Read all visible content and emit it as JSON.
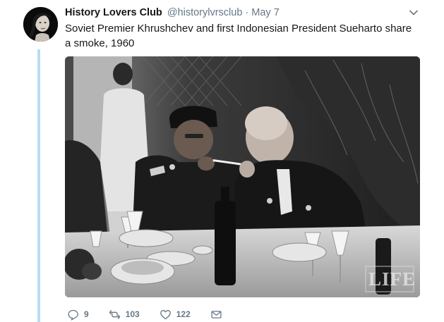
{
  "tweet": {
    "author_name": "History Lovers Club",
    "author_handle": "@historylvrsclub",
    "separator": "·",
    "date": "May 7",
    "text": "Soviet Premier Khrushchev and first Indonesian President Sueharto share a smoke, 1960",
    "media": {
      "watermark": "LIFE",
      "tone": "black-and-white photograph"
    },
    "actions": {
      "replies": "9",
      "retweets": "103",
      "likes": "122"
    }
  },
  "icons": {
    "caret": "chevron-down-icon",
    "reply": "reply-icon",
    "retweet": "retweet-icon",
    "like": "heart-icon",
    "dm": "envelope-icon"
  },
  "colors": {
    "thread_line": "#b8dcf2",
    "secondary_text": "#657786",
    "primary_text": "#14171a"
  }
}
